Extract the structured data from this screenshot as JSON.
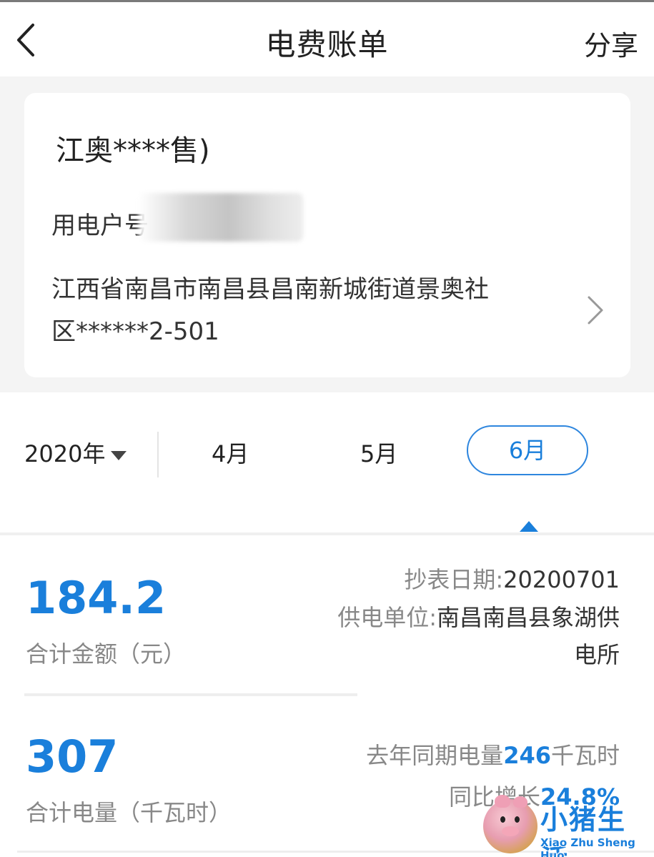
{
  "header": {
    "title": "电费账单",
    "share_label": "分享"
  },
  "account": {
    "company": "江奥****售)",
    "account_label": "用电户号",
    "address": "江西省南昌市南昌县昌南新城街道景奥社区******2-501"
  },
  "period": {
    "year_label": "2020年",
    "months": [
      "4月",
      "5月",
      "6月"
    ],
    "selected_month": "6月"
  },
  "bill": {
    "total_amount": "184.2",
    "total_amount_label": "合计金额（元）",
    "read_date_label": "抄表日期:",
    "read_date_value": "20200701",
    "supplier_label": "供电单位:",
    "supplier_value": "南昌南昌县象湖供电所",
    "total_energy": "307",
    "total_energy_label": "合计电量（千瓦时）",
    "last_year_label": "去年同期电量",
    "last_year_value": "246",
    "last_year_unit": "千瓦时",
    "growth_label": "同比增长",
    "growth_value": "24.8%"
  },
  "watermark": {
    "title": "小猪生活",
    "subtitle": "Xiao Zhu Sheng Huo"
  },
  "colors": {
    "accent": "#1a7fdb",
    "background_band": "#f4f4f4"
  },
  "icons": [
    "back-arrow-icon",
    "chevron-right-icon",
    "dropdown-triangle-icon",
    "selected-caret-icon"
  ]
}
